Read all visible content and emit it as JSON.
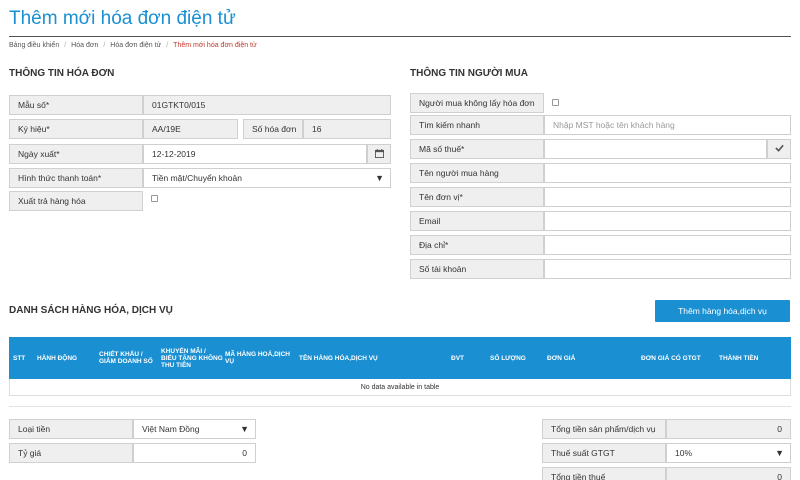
{
  "page": {
    "title": "Thêm mới hóa đơn điện tử"
  },
  "breadcrumb": [
    "Bảng điều khiển",
    "Hóa đơn",
    "Hóa đơn điện tử",
    "Thêm mới hóa đơn điện tử"
  ],
  "invoice_info": {
    "title": "THÔNG TIN HÓA ĐƠN",
    "template_label": "Mẫu số*",
    "template_value": "01GTKT0/015",
    "serial_label": "Ký hiệu*",
    "serial_value": "AA/19E",
    "number_label": "Số hóa đơn",
    "number_value": "16",
    "date_label": "Ngày xuất*",
    "date_value": "12-12-2019",
    "payment_label": "Hình thức thanh toán*",
    "payment_value": "Tiền mặt/Chuyển khoản",
    "return_label": "Xuất trả hàng hóa"
  },
  "buyer_info": {
    "title": "THÔNG TIN NGƯỜI MUA",
    "no_invoice_label": "Người mua không lấy hóa đơn",
    "quick_search_label": "Tìm kiếm nhanh",
    "quick_search_placeholder": "Nhập MST hoặc tên khách hàng",
    "tax_code_label": "Mã số thuế*",
    "buyer_name_label": "Tên người mua hàng",
    "unit_name_label": "Tên đơn vị*",
    "email_label": "Email",
    "address_label": "Địa chỉ*",
    "account_label": "Số tài khoản"
  },
  "goods": {
    "title": "DANH SÁCH HÀNG HÓA, DỊCH VỤ",
    "add_button": "Thêm hàng hóa,dịch vụ",
    "columns": [
      "STT",
      "HÀNH ĐỘNG",
      "CHIẾT KHẤU / GIẢM DOANH SỐ",
      "KHUYẾN MÃI / BIẾU TẶNG KHÔNG THU TIỀN",
      "MÃ HÀNG HOÁ,DỊCH VỤ",
      "TÊN HÀNG HÓA,DỊCH VỤ",
      "ĐVT",
      "SỐ LƯỢNG",
      "ĐƠN GIÁ",
      "ĐƠN GIÁ CÓ GTGT",
      "THÀNH TIỀN"
    ],
    "empty_text": "No data available in table"
  },
  "footer": {
    "currency_label": "Loại tiền",
    "currency_value": "Việt Nam Đồng",
    "rate_label": "Tỷ giá",
    "rate_value": "0",
    "total_goods_label": "Tổng tiền sản phẩm/dịch vụ",
    "total_goods_value": "0",
    "vat_rate_label": "Thuế suất GTGT",
    "vat_rate_value": "10%",
    "total_tax_label": "Tổng tiền thuế",
    "total_tax_value": "0"
  },
  "colors": {
    "accent": "#1a8fd2",
    "breadcrumb_current": "#c0392b",
    "label_bg": "#efefef"
  },
  "icons": {
    "date": "calendar-icon",
    "tax_check": "check-icon",
    "dropdown": "caret-down-icon"
  }
}
